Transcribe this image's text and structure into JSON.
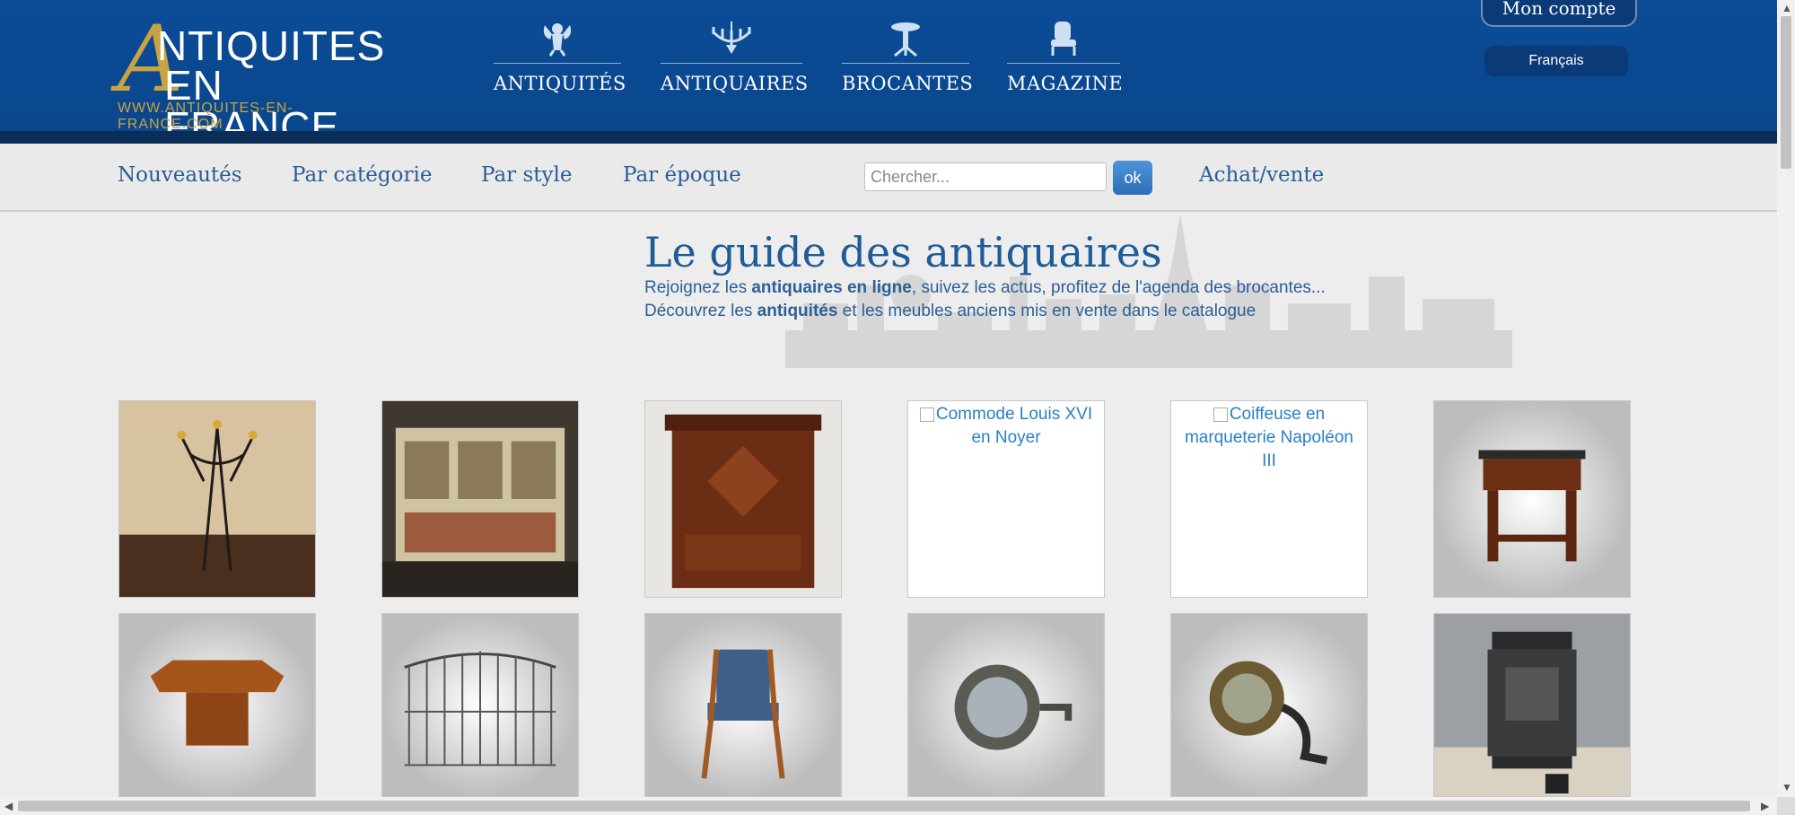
{
  "header": {
    "logo_letter": "A",
    "logo_line1": "NTIQUITES",
    "logo_line2": "EN FRANCE",
    "logo_url": "WWW.ANTIQUITES-EN-FRANCE.COM",
    "nav": [
      {
        "label": "ANTIQUITÉS",
        "icon": "cherub-icon"
      },
      {
        "label": "ANTIQUAIRES",
        "icon": "chandelier-icon"
      },
      {
        "label": "BROCANTES",
        "icon": "pedestal-table-icon"
      },
      {
        "label": "MAGAZINE",
        "icon": "armchair-icon"
      }
    ],
    "account_label": "Mon compte",
    "language_label": "Français"
  },
  "subnav": {
    "links": [
      "Nouveautés",
      "Par catégorie",
      "Par style",
      "Par époque"
    ],
    "search_placeholder": "Chercher...",
    "search_button": "ok",
    "buy_sell": "Achat/vente"
  },
  "hero": {
    "title": "Le guide des antiquaires",
    "line1_pre": "Rejoignez les ",
    "line1_bold": "antiquaires en ligne",
    "line1_post": ", suivez les actus, profitez de l'agenda des brocantes...",
    "line2_pre": "Découvrez les ",
    "line2_bold": "antiquités",
    "line2_post": " et les meubles anciens mis en vente dans le catalogue"
  },
  "products": {
    "row1": [
      {
        "kind": "image",
        "subject": "wrought-iron-coat-stand"
      },
      {
        "kind": "image",
        "subject": "painted-bookcase-cabinet"
      },
      {
        "kind": "image",
        "subject": "walnut-armoire"
      },
      {
        "kind": "broken",
        "alt": "Commode Louis XVI en Noyer"
      },
      {
        "kind": "broken",
        "alt": "Coiffeuse en marqueterie Napoléon III"
      },
      {
        "kind": "image",
        "subject": "mahogany-console"
      }
    ],
    "row2": [
      {
        "kind": "image",
        "subject": "octagonal-table"
      },
      {
        "kind": "image",
        "subject": "iron-gate"
      },
      {
        "kind": "image",
        "subject": "upholstered-chair"
      },
      {
        "kind": "image",
        "subject": "brass-projector-lamp"
      },
      {
        "kind": "image",
        "subject": "brass-ship-lamp"
      },
      {
        "kind": "image",
        "subject": "cast-iron-stove"
      }
    ]
  },
  "colors": {
    "header_blue": "#0b4c96",
    "gold": "#c8a341",
    "link_blue": "#2a5d95",
    "title_blue": "#1e5c98"
  }
}
